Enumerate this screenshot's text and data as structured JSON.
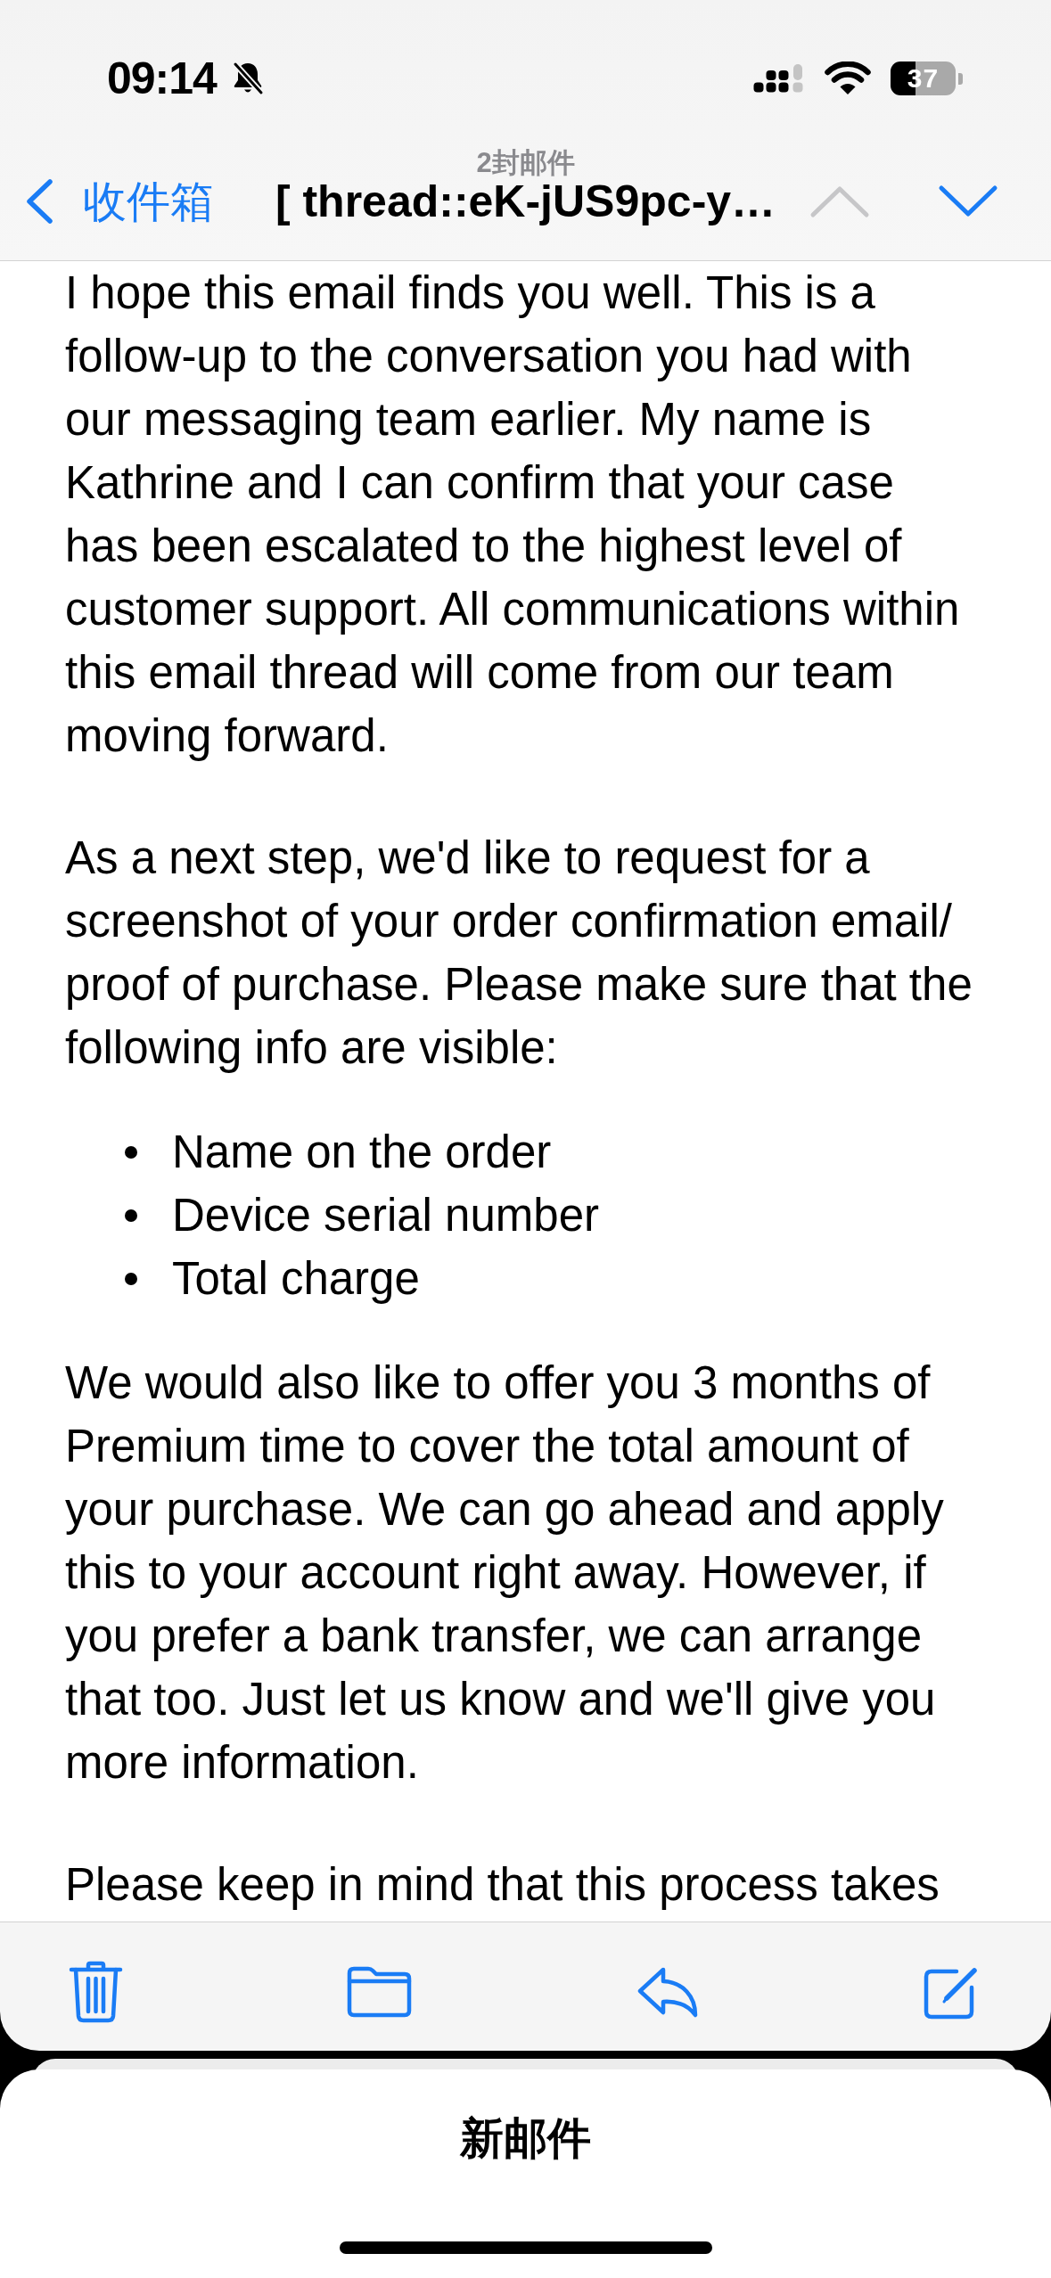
{
  "status_bar": {
    "time": "09:14",
    "battery": "37"
  },
  "nav": {
    "back": "收件箱",
    "message_count": "2封邮件",
    "subject": "[ thread::eK-jUS9pc-y…",
    "arrows": [
      {
        "kind": "up",
        "disabled": true
      },
      {
        "kind": "down",
        "disabled": false
      }
    ]
  },
  "body": [
    {
      "kind": "paragraph",
      "text": "I hope this email finds you well. This is a follow-up to the conversation you had with our messaging team earlier. My name is Kathrine and I can confirm that your case has been escalated to the highest level of customer support. All communications within this email thread will come from our team moving forward."
    },
    {
      "kind": "paragraph",
      "text": "As a next step, we'd like to request for a screenshot of your order confirmation email/proof of purchase. Please make sure that the following info are visible:"
    },
    {
      "kind": "list",
      "items": [
        "Name on the order",
        "Device serial number",
        "Total charge"
      ]
    },
    {
      "kind": "paragraph",
      "text": "We would also like to offer you 3 months of Premium time to cover the total amount of your purchase. We can go ahead and apply this to your account right away. However, if you prefer a bank transfer, we can arrange that too. Just let us know and we'll give you more information."
    },
    {
      "kind": "paragraph",
      "text": "Please keep in mind that this process takes"
    }
  ],
  "draft": {
    "title": "新邮件"
  }
}
